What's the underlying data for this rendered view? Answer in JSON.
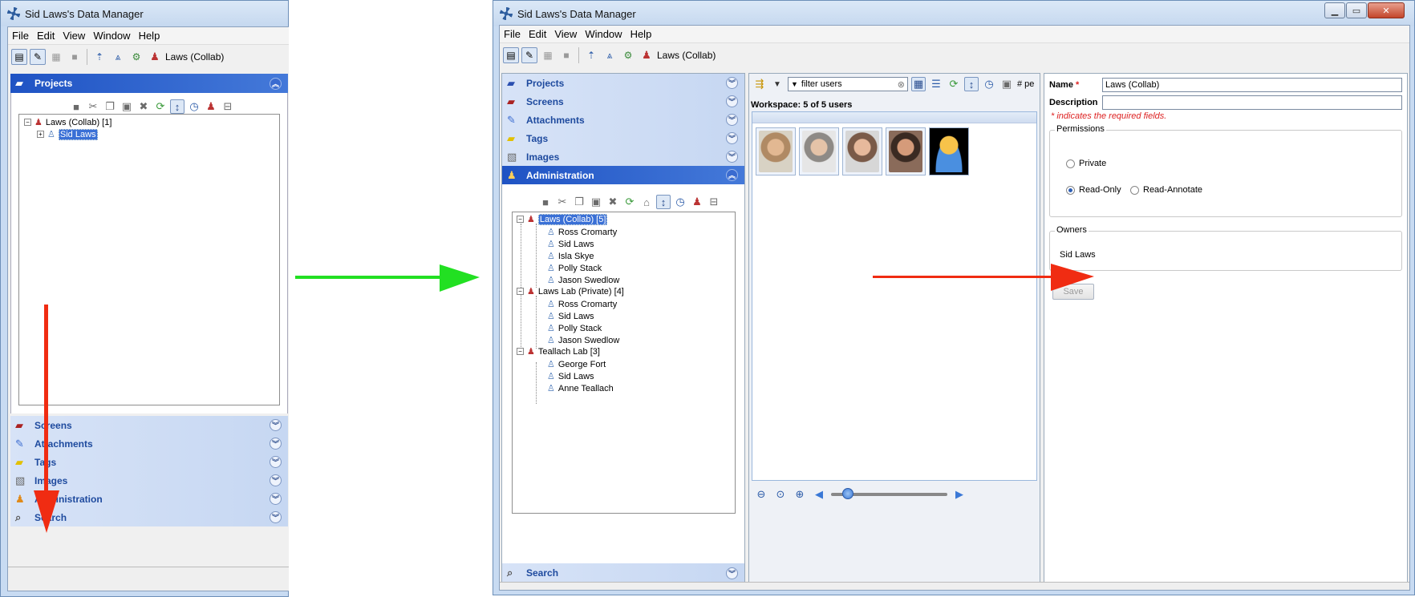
{
  "window_title": "Sid Laws's Data Manager",
  "menu": [
    "File",
    "Edit",
    "View",
    "Window",
    "Help"
  ],
  "toolbar": {
    "group_label": "Laws (Collab)"
  },
  "left_window": {
    "accordion_top": {
      "label": "Projects"
    },
    "tree": {
      "root": "Laws (Collab) [1]",
      "child": "Sid Laws"
    },
    "accordion_bottom": [
      "Screens",
      "Attachments",
      "Tags",
      "Images",
      "Administration",
      "Search"
    ]
  },
  "right_window": {
    "accordion": [
      "Projects",
      "Screens",
      "Attachments",
      "Tags",
      "Images",
      "Administration"
    ],
    "search_label": "Search",
    "tree": {
      "groups": [
        {
          "name": "Laws (Collab) [5]",
          "members": [
            "Ross Cromarty",
            "Sid Laws",
            "Isla Skye",
            "Polly Stack",
            "Jason Swedlow"
          ]
        },
        {
          "name": "Laws Lab (Private) [4]",
          "members": [
            "Ross Cromarty",
            "Sid Laws",
            "Polly Stack",
            "Jason Swedlow"
          ]
        },
        {
          "name": "Teallach Lab [3]",
          "members": [
            "George Fort",
            "Sid Laws",
            "Anne Teallach"
          ]
        }
      ]
    },
    "filter": {
      "placeholder": "filter users",
      "extra": "# pe"
    },
    "workspace_label": "Workspace: 5 of 5 users",
    "photo_colors": [
      "#b08a64",
      "#8e8a86",
      "#7a5a48",
      "#6b4a3c",
      "#f2b318"
    ],
    "editor": {
      "name_label": "Name",
      "required_mark": "*",
      "name_value": "Laws (Collab)",
      "description_label": "Description",
      "required_note": "* indicates the required fields.",
      "permissions_legend": "Permissions",
      "perm_private": "Private",
      "perm_read_only": "Read-Only",
      "perm_read_annotate": "Read-Annotate",
      "owners_legend": "Owners",
      "owner": "Sid Laws",
      "save_label": "Save"
    }
  },
  "colors": {
    "arrow_green": "#22e022",
    "arrow_red": "#f02c12",
    "selection": "#1f53c4"
  }
}
